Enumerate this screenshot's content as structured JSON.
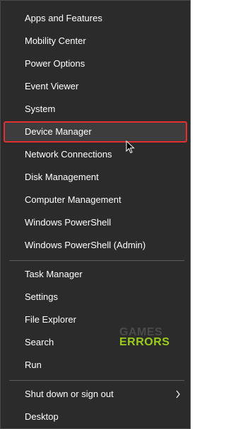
{
  "menu": {
    "group1": [
      "Apps and Features",
      "Mobility Center",
      "Power Options",
      "Event Viewer",
      "System",
      "Device Manager",
      "Network Connections",
      "Disk Management",
      "Computer Management",
      "Windows PowerShell",
      "Windows PowerShell (Admin)"
    ],
    "group2": [
      "Task Manager",
      "Settings",
      "File Explorer",
      "Search",
      "Run"
    ],
    "group3": [
      "Shut down or sign out",
      "Desktop"
    ],
    "highlighted_item": "Device Manager"
  },
  "watermark": {
    "line1": "GAMES",
    "line2": "ERRORS"
  },
  "icons": {
    "submenu_arrow": "chevron-right-icon",
    "pointer": "mouse-cursor-icon"
  },
  "colors": {
    "menu_background": "#2b2b2b",
    "highlight_border": "#e03030",
    "highlight_background": "#3d3d3d",
    "watermark_accent": "#9acd1b"
  }
}
